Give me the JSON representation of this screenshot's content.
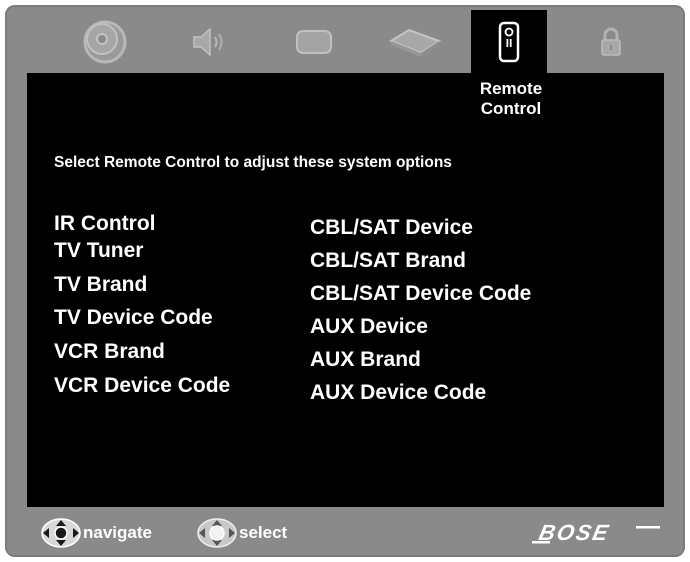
{
  "tabs": [
    {
      "id": "disc",
      "icon": "disc-icon",
      "active": false
    },
    {
      "id": "audio",
      "icon": "speaker-icon",
      "active": false
    },
    {
      "id": "video",
      "icon": "display-icon",
      "active": false
    },
    {
      "id": "system",
      "icon": "device-icon",
      "active": false
    },
    {
      "id": "remote",
      "icon": "remote-control-icon",
      "active": true,
      "label_line1": "Remote",
      "label_line2": "Control"
    },
    {
      "id": "lock",
      "icon": "lock-icon",
      "active": false
    }
  ],
  "main": {
    "instruction": "Select Remote Control to adjust these system options",
    "left_options": [
      "IR Control",
      "TV Tuner",
      "TV Brand",
      "TV Device Code",
      "VCR Brand",
      "VCR Device Code"
    ],
    "right_options": [
      "CBL/SAT Device",
      "CBL/SAT Brand",
      "CBL/SAT Device Code",
      "AUX Device",
      "AUX Brand",
      "AUX Device Code"
    ]
  },
  "footer": {
    "navigate_label": "navigate",
    "select_label": "select",
    "brand": "BOSE"
  },
  "colors": {
    "frame": "#8a8a8a",
    "screen": "#000000",
    "inactive_icon": "#b2b2b2",
    "text": "#ffffff"
  }
}
